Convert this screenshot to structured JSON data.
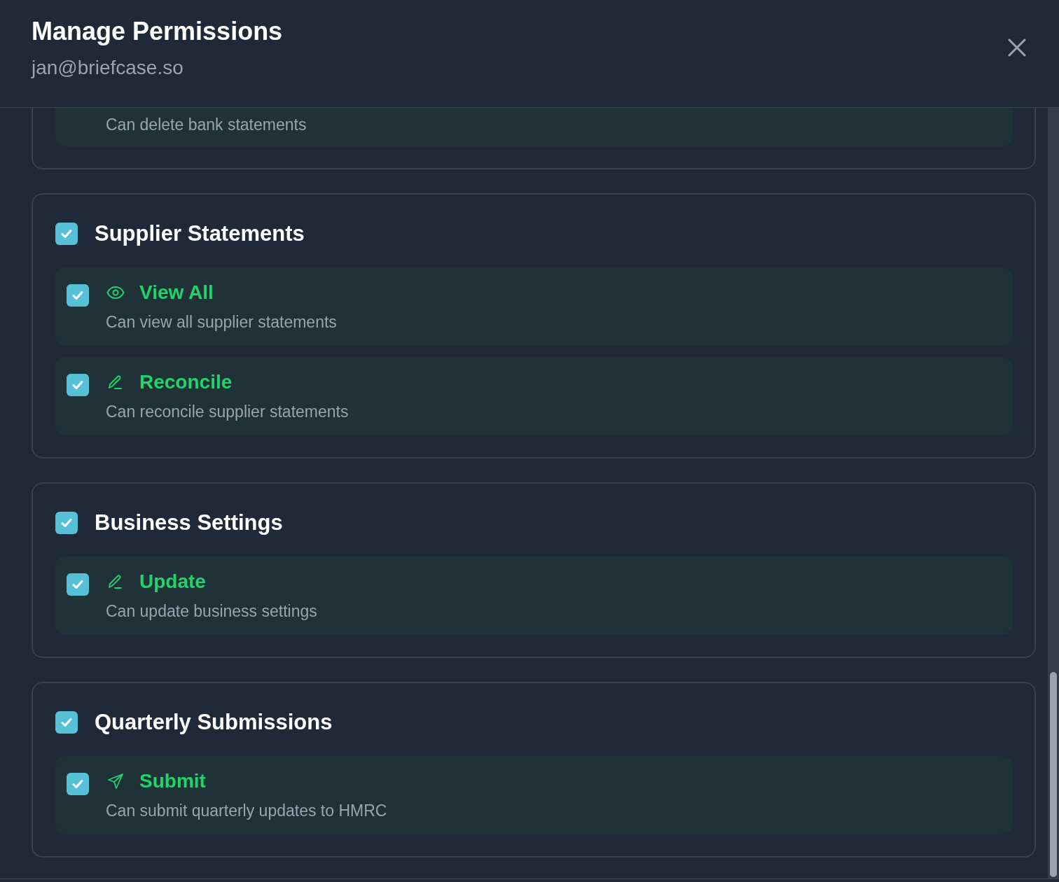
{
  "dialog": {
    "title": "Manage Permissions",
    "subtitle": "jan@briefcase.so"
  },
  "partial_section": {
    "items": [
      {
        "description": "Can delete bank statements"
      }
    ]
  },
  "sections": [
    {
      "title": "Supplier Statements",
      "checked": true,
      "items": [
        {
          "kind": "view",
          "label": "View All",
          "description": "Can view all supplier statements",
          "checked": true
        },
        {
          "kind": "edit",
          "label": "Reconcile",
          "description": "Can reconcile supplier statements",
          "checked": true
        }
      ]
    },
    {
      "title": "Business Settings",
      "checked": true,
      "items": [
        {
          "kind": "edit",
          "label": "Update",
          "description": "Can update business settings",
          "checked": true
        }
      ]
    },
    {
      "title": "Quarterly Submissions",
      "checked": true,
      "items": [
        {
          "kind": "send",
          "label": "Submit",
          "description": "Can submit quarterly updates to HMRC",
          "checked": true
        }
      ]
    }
  ]
}
